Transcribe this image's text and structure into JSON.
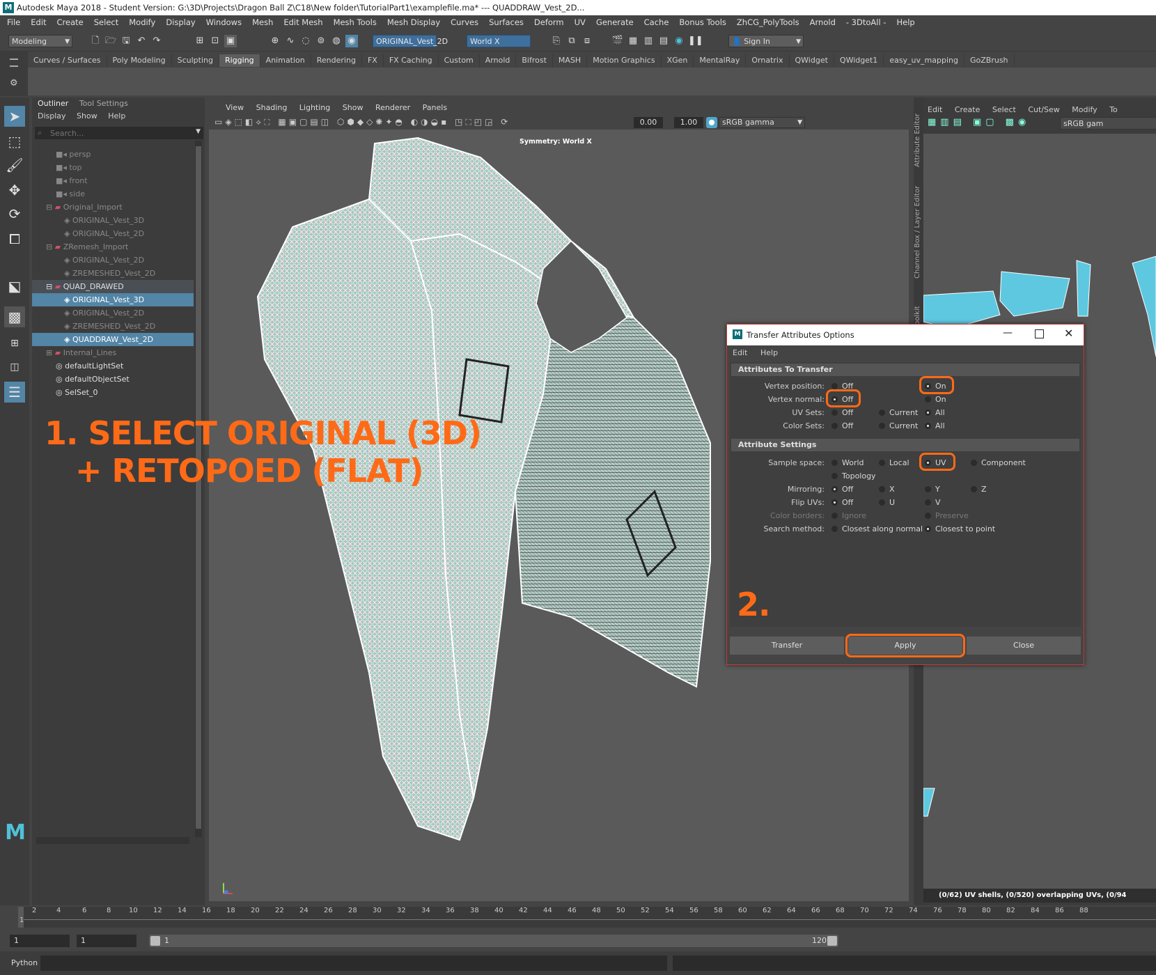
{
  "window": {
    "title": "Autodesk Maya 2018 - Student Version: G:\\3D\\Projects\\Dragon Ball Z\\C18\\New folder\\TutorialPart1\\examplefile.ma*  ---  QUADDRAW_Vest_2D...",
    "logo": "M"
  },
  "menubar": [
    "File",
    "Edit",
    "Create",
    "Select",
    "Modify",
    "Display",
    "Windows",
    "Mesh",
    "Edit Mesh",
    "Mesh Tools",
    "Mesh Display",
    "Curves",
    "Surfaces",
    "Deform",
    "UV",
    "Generate",
    "Cache",
    "Bonus Tools",
    "ZhCG_PolyTools",
    "Arnold",
    "- 3DtoAll -",
    "Help"
  ],
  "statusline": {
    "mode": "Modeling",
    "object_field": "ORIGINAL_Vest_2D",
    "symmetry_field": "World X",
    "signin": "Sign In"
  },
  "shelf_tabs": [
    "Curves / Surfaces",
    "Poly Modeling",
    "Sculpting",
    "Rigging",
    "Animation",
    "Rendering",
    "FX",
    "FX Caching",
    "Custom",
    "Arnold",
    "Bifrost",
    "MASH",
    "Motion Graphics",
    "XGen",
    "MentalRay",
    "Ornatrix",
    "QWidget",
    "QWidget1",
    "easy_uv_mapping",
    "GoZBrush"
  ],
  "shelf_active": "Rigging",
  "outliner": {
    "tabs": [
      "Outliner",
      "Tool Settings"
    ],
    "menu": [
      "Display",
      "Show",
      "Help"
    ],
    "search_placeholder": "Search...",
    "items": [
      {
        "label": "persp"
      },
      {
        "label": "top"
      },
      {
        "label": "front"
      },
      {
        "label": "side"
      },
      {
        "label": "Original_Import"
      },
      {
        "label": "ORIGINAL_Vest_3D"
      },
      {
        "label": "ORIGINAL_Vest_2D"
      },
      {
        "label": "ZRemesh_Import"
      },
      {
        "label": "ORIGINAL_Vest_2D"
      },
      {
        "label": "ZREMESHED_Vest_2D"
      },
      {
        "label": "QUAD_DRAWED"
      },
      {
        "label": "ORIGINAL_Vest_3D"
      },
      {
        "label": "ORIGINAL_Vest_2D"
      },
      {
        "label": "ZREMESHED_Vest_2D"
      },
      {
        "label": "QUADDRAW_Vest_2D"
      },
      {
        "label": "Internal_Lines"
      },
      {
        "label": "defaultLightSet"
      },
      {
        "label": "defaultObjectSet"
      },
      {
        "label": "SelSet_0"
      }
    ]
  },
  "viewport": {
    "menu": [
      "View",
      "Shading",
      "Lighting",
      "Show",
      "Renderer",
      "Panels"
    ],
    "value1": "0.00",
    "value2": "1.00",
    "colorspace": "sRGB gamma",
    "hud_symmetry": "Symmetry: World X"
  },
  "uv_editor": {
    "side_tabs": [
      "Attribute Editor",
      "Channel Box / Layer Editor",
      "Modeling Toolkit"
    ],
    "menu": [
      "Edit",
      "Create",
      "Select",
      "Cut/Sew",
      "Modify",
      "To"
    ],
    "colorspace": "sRGB gam",
    "status": "(0/62) UV shells, (0/520) overlapping UVs, (0/94"
  },
  "dialog": {
    "title": "Transfer Attributes Options",
    "menu": [
      "Edit",
      "Help"
    ],
    "section1": "Attributes To Transfer",
    "section2": "Attribute Settings",
    "rows": {
      "vertex_position": {
        "label": "Vertex position:",
        "opts": [
          "Off",
          "On"
        ]
      },
      "vertex_normal": {
        "label": "Vertex normal:",
        "opts": [
          "Off",
          "On"
        ]
      },
      "uv_sets": {
        "label": "UV Sets:",
        "opts": [
          "Off",
          "Current",
          "All"
        ]
      },
      "color_sets": {
        "label": "Color Sets:",
        "opts": [
          "Off",
          "Current",
          "All"
        ]
      },
      "sample_space": {
        "label": "Sample space:",
        "opts": [
          "World",
          "Local",
          "UV",
          "Component",
          "Topology"
        ]
      },
      "mirroring": {
        "label": "Mirroring:",
        "opts": [
          "Off",
          "X",
          "Y",
          "Z"
        ]
      },
      "flip_uvs": {
        "label": "Flip UVs:",
        "opts": [
          "Off",
          "U",
          "V"
        ]
      },
      "color_borders": {
        "label": "Color borders:",
        "opts": [
          "Ignore",
          "Preserve"
        ]
      },
      "search_method": {
        "label": "Search method:",
        "opts": [
          "Closest along normal",
          "Closest to point"
        ]
      }
    },
    "buttons": {
      "transfer": "Transfer",
      "apply": "Apply",
      "close": "Close"
    }
  },
  "annotations": {
    "step1_line1": "1. SELECT ORIGINAL (3D)",
    "step1_line2": "+ RETOPOED (FLAT)",
    "step2": "2.",
    "accent": "#ff6a17"
  },
  "timeline": {
    "ticks": [
      "1",
      "2",
      "4",
      "6",
      "8",
      "10",
      "12",
      "14",
      "16",
      "18",
      "20",
      "22",
      "24",
      "26",
      "28",
      "30",
      "32",
      "34",
      "36",
      "38",
      "40",
      "42",
      "44",
      "46",
      "48",
      "50",
      "52",
      "54",
      "56",
      "58",
      "60",
      "62",
      "64",
      "66",
      "68",
      "70",
      "72",
      "74",
      "76",
      "78",
      "80",
      "82",
      "84",
      "86",
      "88"
    ],
    "range_start": "1",
    "range_start2": "1",
    "range_inner_start": "1",
    "range_inner_end": "120"
  },
  "cmdline": {
    "lang": "Python"
  },
  "colors": {
    "selection": "#5285a6",
    "wire": "#6fe0c2",
    "uv_shell": "#5ec8e0"
  }
}
